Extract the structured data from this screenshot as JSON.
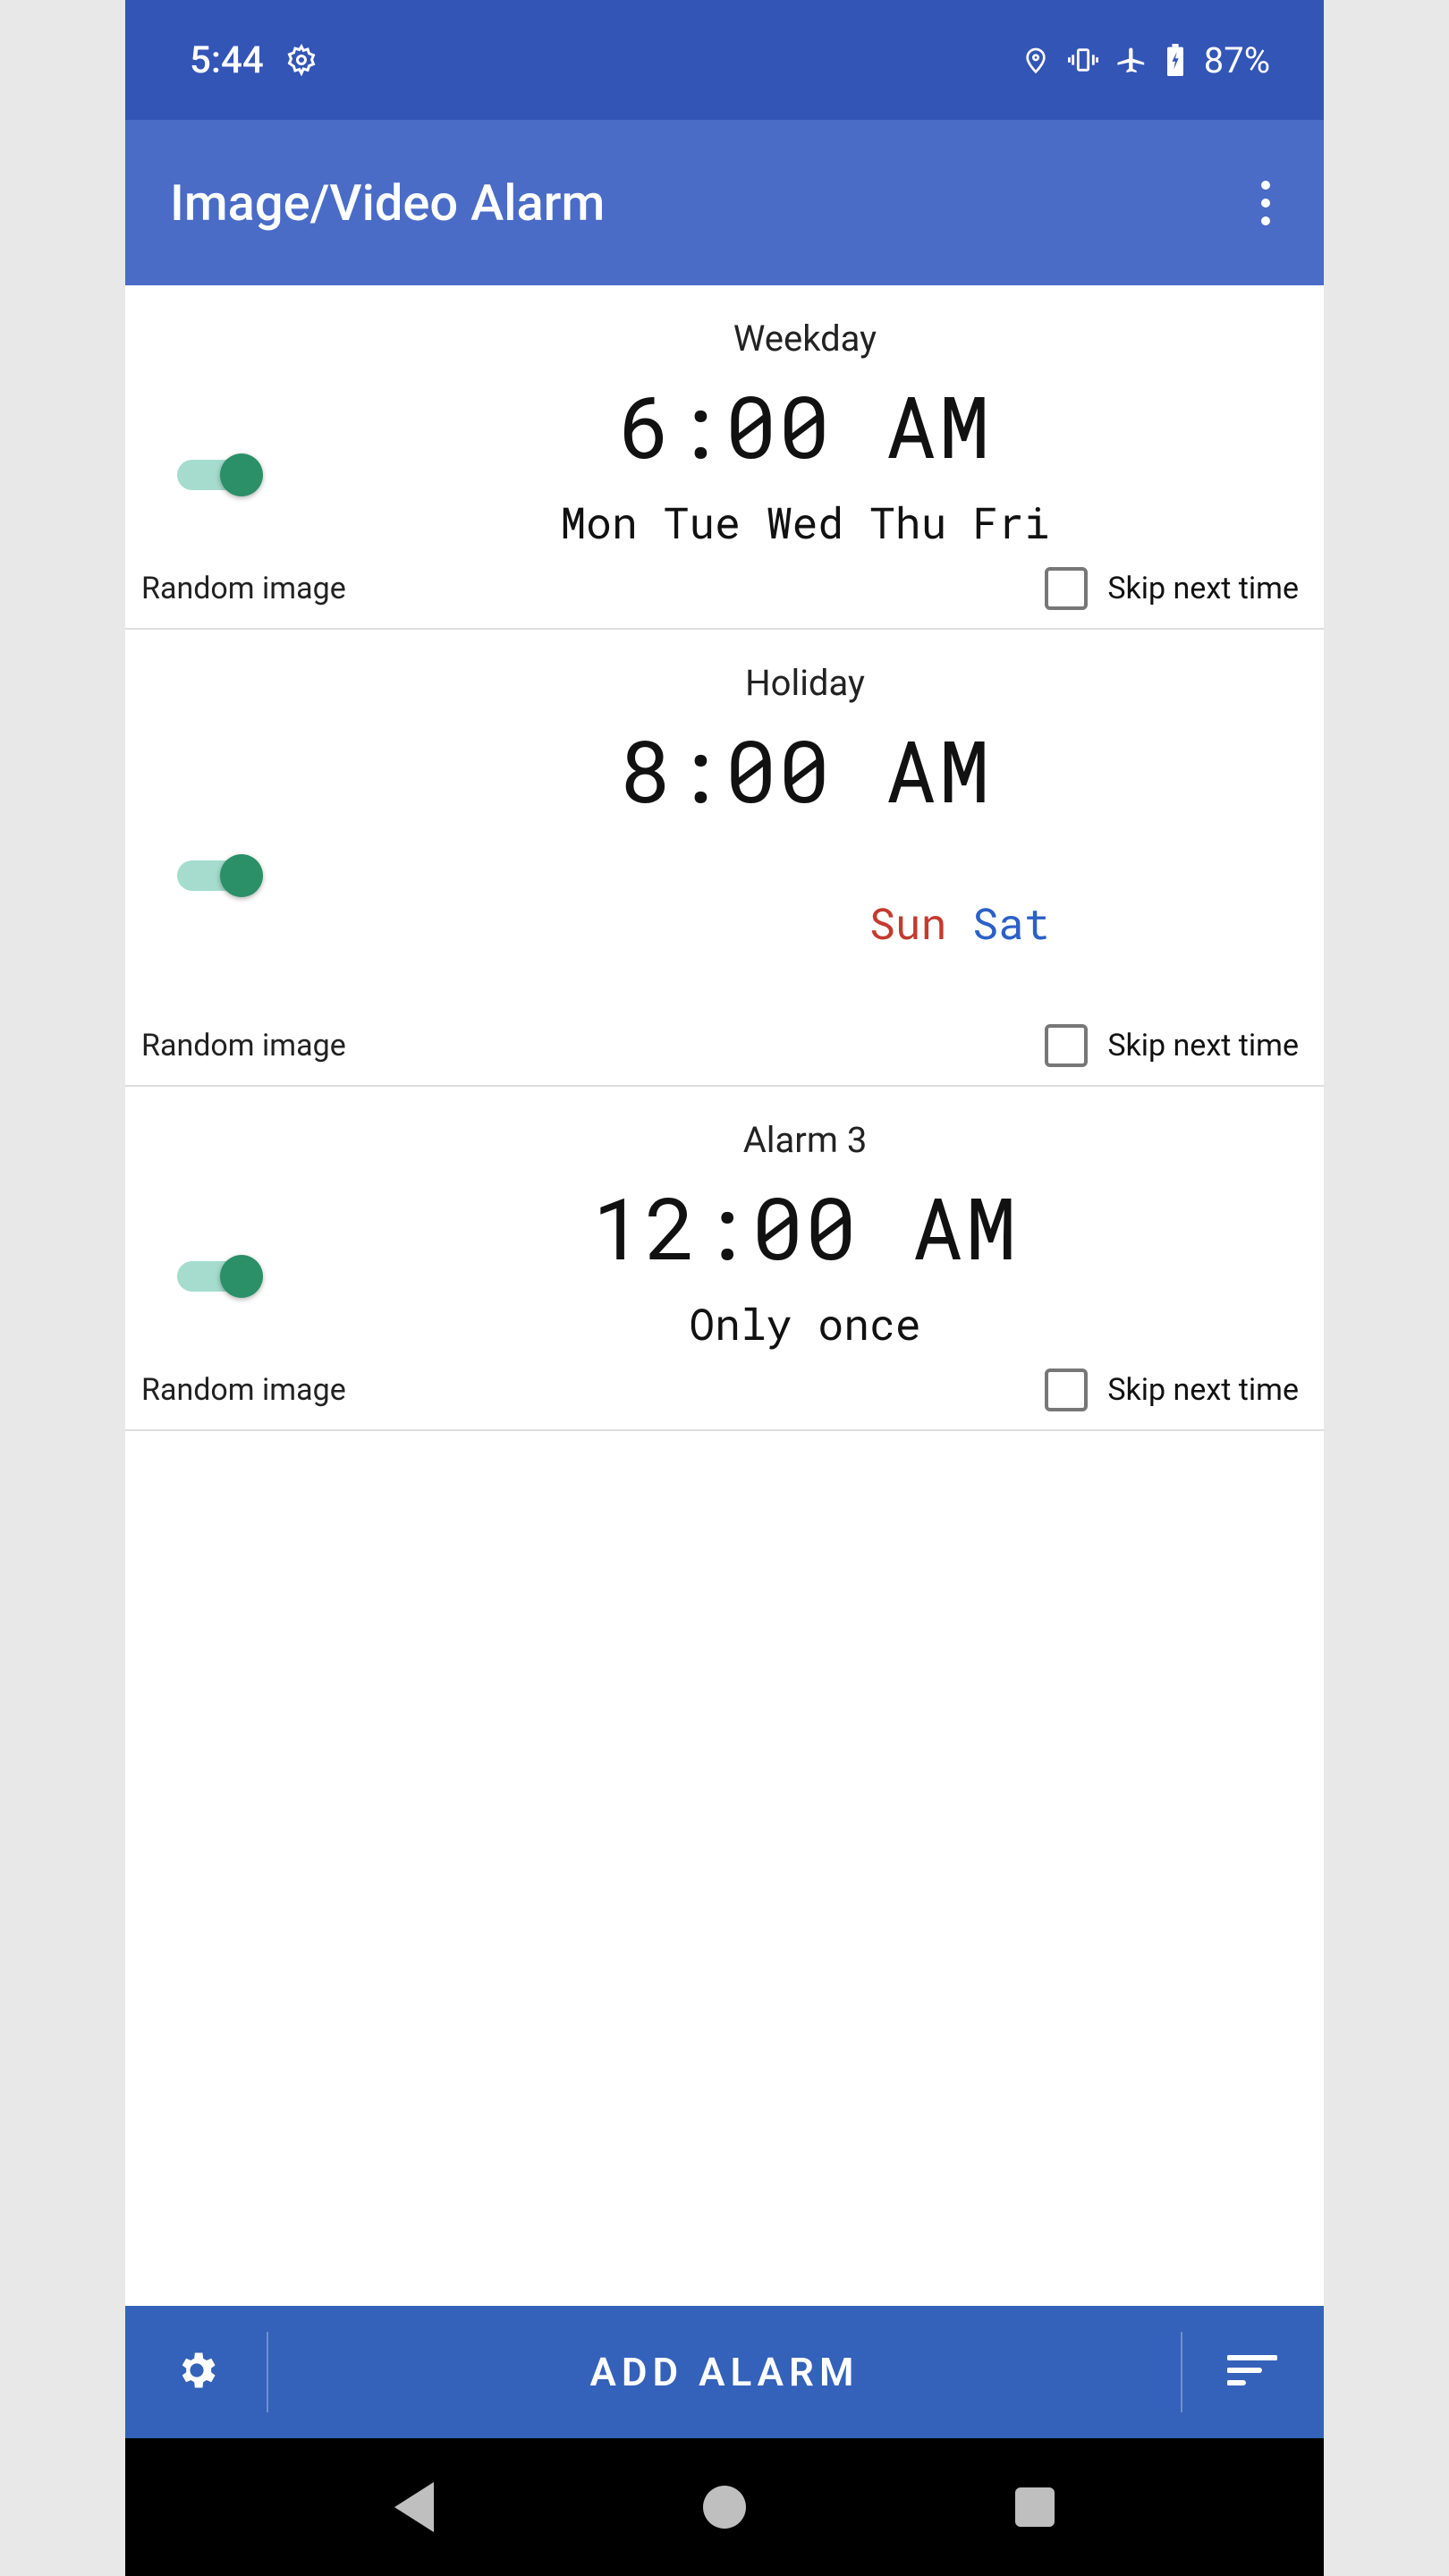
{
  "status": {
    "time": "5:44",
    "battery": "87%"
  },
  "appbar": {
    "title": "Image/Video Alarm"
  },
  "alarms": [
    {
      "title": "Weekday",
      "time": "6:00 AM",
      "days_plain": "Mon Tue Wed Thu Fri",
      "sub": "Random image",
      "skip_label": "Skip next time"
    },
    {
      "title": "Holiday",
      "time": "8:00 AM",
      "day_sun": "Sun",
      "day_sat": "Sat",
      "sub": "Random image",
      "skip_label": "Skip next time"
    },
    {
      "title": "Alarm 3",
      "time": "12:00 AM",
      "days_plain": "Only once",
      "sub": "Random image",
      "skip_label": "Skip next time"
    }
  ],
  "bottom": {
    "add": "ADD ALARM"
  }
}
